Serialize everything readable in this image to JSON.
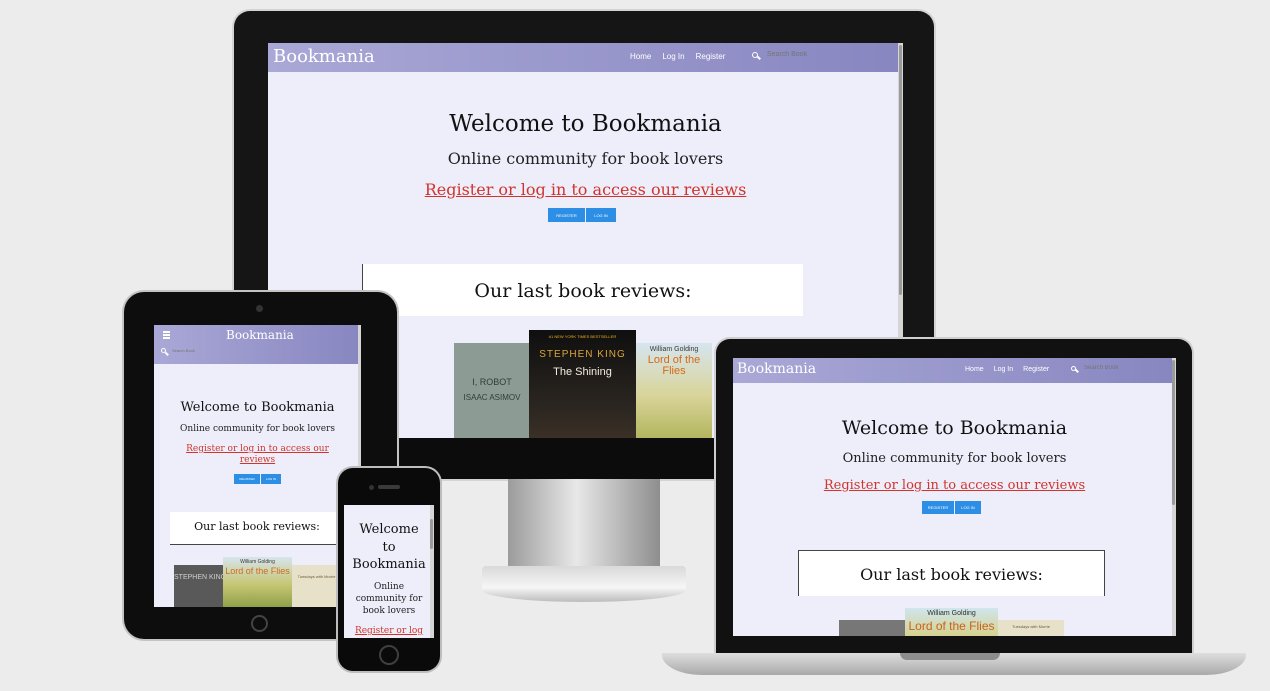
{
  "site": {
    "brand": "Bookmania",
    "nav": {
      "home": "Home",
      "login": "Log In",
      "register": "Register",
      "search_placeholder": "Search Book"
    },
    "hero": {
      "title": "Welcome to Bookmania",
      "subtitle": "Online community for book lovers",
      "cta": "Register or log in to access our reviews",
      "register_button": "Register",
      "login_button": "Log In"
    },
    "reviews": {
      "heading": "Our last book reviews:"
    },
    "books": [
      {
        "cover_title": "I, ROBOT",
        "cover_author": "ISAAC ASIMOV"
      },
      {
        "cover_tagline": "#1 NEW YORK TIMES BESTSELLER",
        "cover_author": "STEPHEN KING",
        "cover_title": "The Shining"
      },
      {
        "cover_author": "William Golding",
        "cover_title": "Lord of the Flies"
      },
      {
        "cover_title": "Tuesdays with Morrie"
      }
    ],
    "phone_hero_title_lines": [
      "Welcome",
      "to",
      "Bookmania"
    ],
    "phone_hero_subtitle_lines": [
      "Online",
      "community for",
      "book lovers"
    ],
    "phone_cta_partial": "Register or log",
    "tablet_cta_lines": [
      "Register or log in to access our",
      "reviews"
    ]
  },
  "colors": {
    "nav_gradient_start": "#a9a8d6",
    "nav_gradient_end": "#8886c0",
    "page_background": "#eeeefb",
    "cta": "#d0342c",
    "button": "#2d8ee6"
  }
}
